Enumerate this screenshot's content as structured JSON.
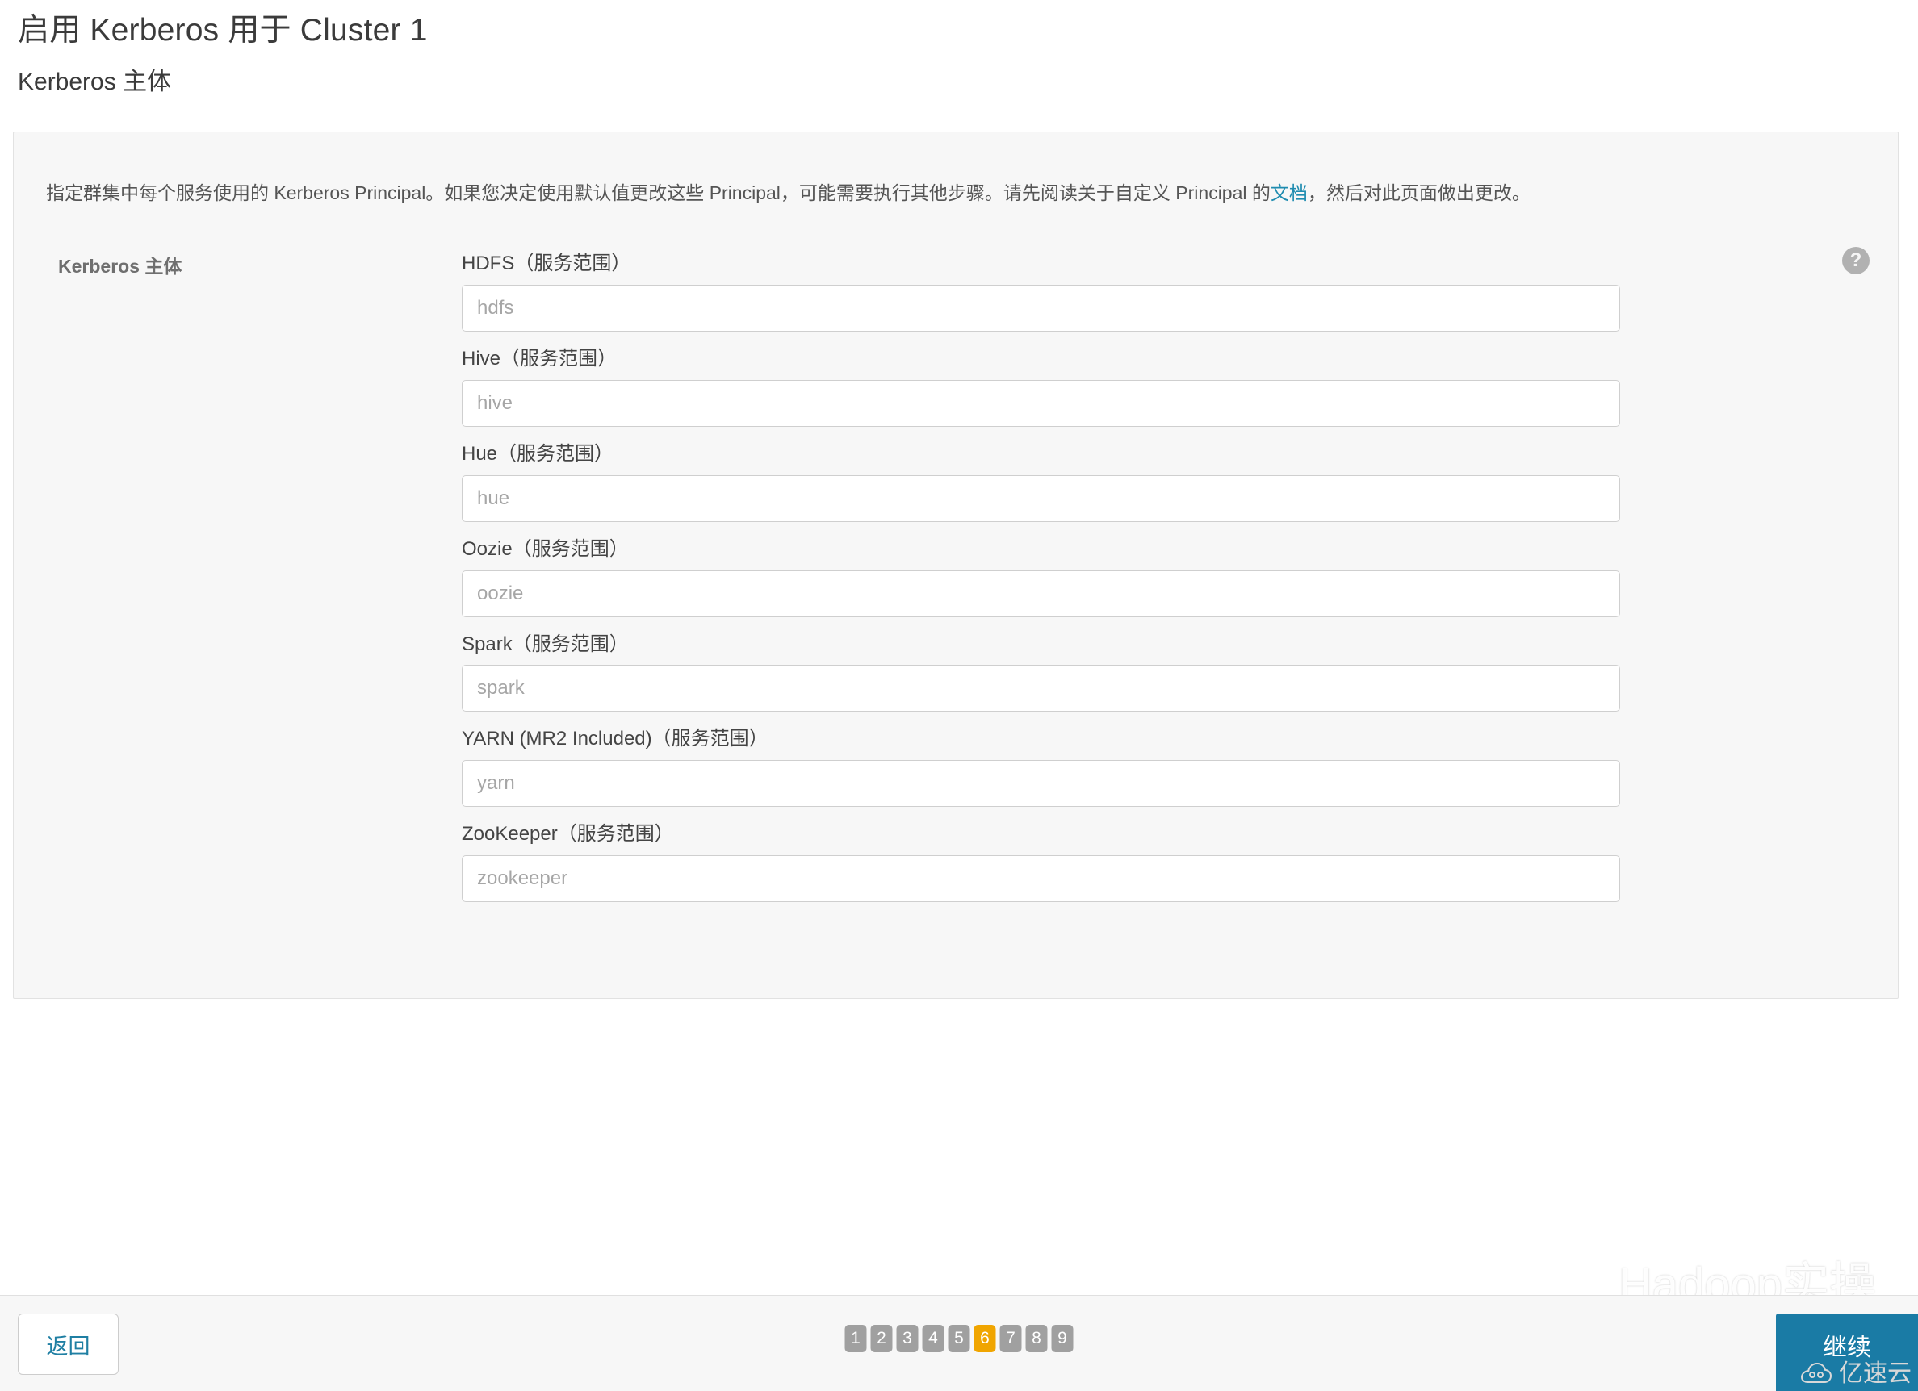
{
  "page": {
    "title": "启用 Kerberos 用于 Cluster 1",
    "subtitle": "Kerberos 主体"
  },
  "panel": {
    "description_part1": "指定群集中每个服务使用的 Kerberos Principal。如果您决定使用默认值更改这些 Principal，可能需要执行其他步骤。请先阅读关于自定义 Principal 的",
    "description_link": "文档",
    "description_part2": "，然后对此页面做出更改。",
    "section_label": "Kerberos 主体",
    "help_icon_glyph": "?",
    "help_icon_name": "question-mark-circle-icon"
  },
  "fields": [
    {
      "label": "HDFS（服务范围）",
      "placeholder": "hdfs",
      "value": "",
      "name": "hdfs"
    },
    {
      "label": "Hive（服务范围）",
      "placeholder": "hive",
      "value": "",
      "name": "hive"
    },
    {
      "label": "Hue（服务范围）",
      "placeholder": "hue",
      "value": "",
      "name": "hue"
    },
    {
      "label": "Oozie（服务范围）",
      "placeholder": "oozie",
      "value": "",
      "name": "oozie"
    },
    {
      "label": "Spark（服务范围）",
      "placeholder": "spark",
      "value": "",
      "name": "spark"
    },
    {
      "label": "YARN (MR2 Included)（服务范围）",
      "placeholder": "yarn",
      "value": "",
      "name": "yarn"
    },
    {
      "label": "ZooKeeper（服务范围）",
      "placeholder": "zookeeper",
      "value": "",
      "name": "zookeeper"
    }
  ],
  "footer": {
    "back_label": "返回",
    "continue_label": "继续",
    "pager": {
      "steps": [
        "1",
        "2",
        "3",
        "4",
        "5",
        "6",
        "7",
        "8",
        "9"
      ],
      "active": "6"
    }
  },
  "watermarks": {
    "main_text": "Hadoop实操",
    "main_icon": "wechat-logo-icon",
    "corner_text": "亿速云",
    "corner_icon": "cloud-logo-icon"
  },
  "colors": {
    "accent_blue": "#1a7ba5",
    "link_teal": "#1f8cb0",
    "pager_active": "#f0a500",
    "pager_inactive": "#a0a0a0",
    "panel_bg": "#f7f7f7"
  }
}
